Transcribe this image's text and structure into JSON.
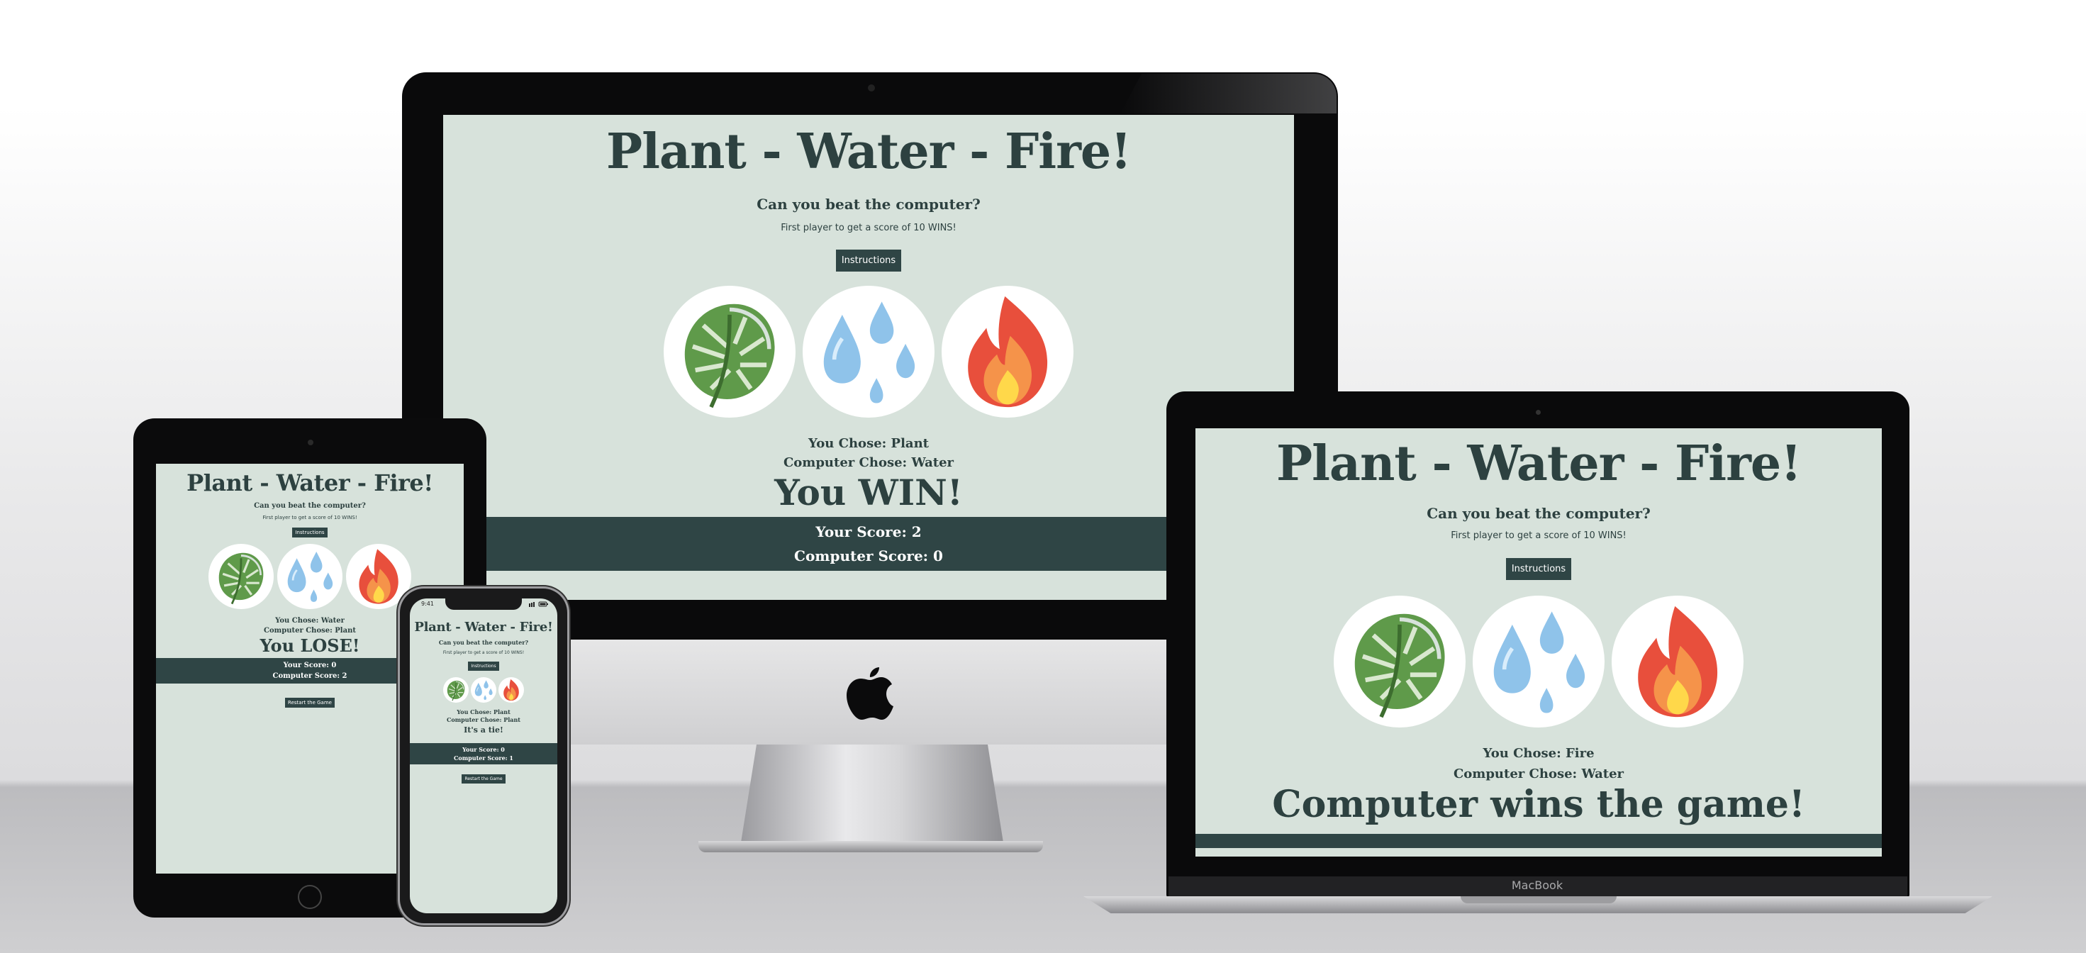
{
  "colors": {
    "screen_background": "#d7e2db",
    "text": "#2d4140",
    "accent_dark": "#2f4545",
    "choice_background": "#ffffff"
  },
  "choices": [
    {
      "name": "plant",
      "icon": "monstera-leaf-icon"
    },
    {
      "name": "water",
      "icon": "water-drops-icon"
    },
    {
      "name": "fire",
      "icon": "flame-icon"
    }
  ],
  "imac": {
    "title": "Plant - Water - Fire!",
    "subtitle": "Can you beat the computer?",
    "rules": "First player to get a score of 10 WINS!",
    "instructions_label": "Instructions",
    "you_chose": "You Chose: Plant",
    "computer_chose": "Computer Chose: Water",
    "result": "You WIN!",
    "your_score": "Your Score: 2",
    "computer_score": "Computer Score: 0"
  },
  "macbook": {
    "title": "Plant - Water - Fire!",
    "subtitle": "Can you beat the computer?",
    "rules": "First player to get a score of 10 WINS!",
    "instructions_label": "Instructions",
    "you_chose": "You Chose: Fire",
    "computer_chose": "Computer Chose: Water",
    "result": "Computer wins the game!",
    "brand": "MacBook"
  },
  "ipad": {
    "title": "Plant - Water - Fire!",
    "subtitle": "Can you beat the computer?",
    "rules": "First player to get a score of 10 WINS!",
    "instructions_label": "Instructions",
    "you_chose": "You Chose: Water",
    "computer_chose": "Computer Chose: Plant",
    "result": "You LOSE!",
    "your_score": "Your Score: 0",
    "computer_score": "Computer Score: 2",
    "restart_label": "Restart the Game"
  },
  "iphone": {
    "status_time": "9:41",
    "title": "Plant - Water - Fire!",
    "subtitle": "Can you beat the computer?",
    "rules": "First player to get a score of 10 WINS!",
    "instructions_label": "Instructions",
    "you_chose": "You Chose: Plant",
    "computer_chose": "Computer Chose: Plant",
    "result": "It's a tie!",
    "your_score": "Your Score: 0",
    "computer_score": "Computer Score: 1",
    "restart_label": "Restart the Game"
  }
}
